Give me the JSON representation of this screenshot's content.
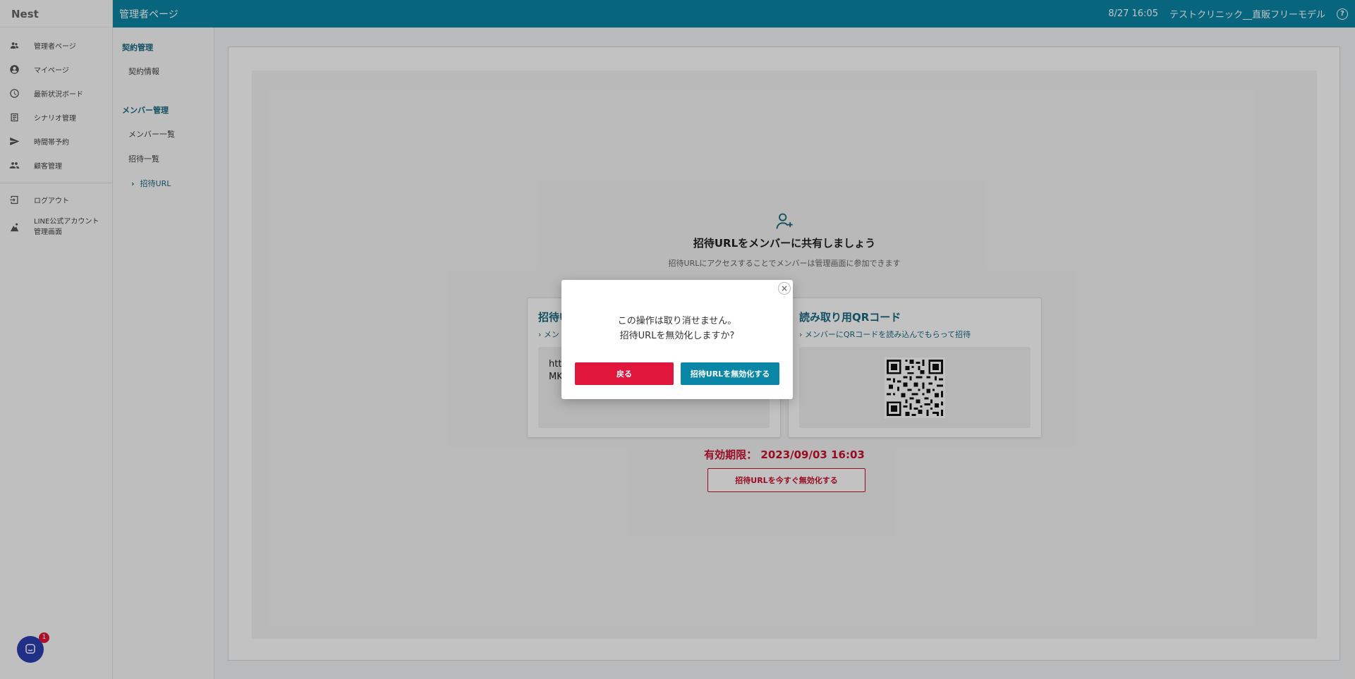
{
  "app": {
    "brand": "Nest"
  },
  "sidebar": {
    "items": [
      {
        "label": "管理者ページ",
        "icon": "users-icon"
      },
      {
        "label": "マイページ",
        "icon": "account-circle-icon"
      },
      {
        "label": "最新状況ボード",
        "icon": "clock-icon"
      },
      {
        "label": "シナリオ管理",
        "icon": "list-icon"
      },
      {
        "label": "時間帯予約",
        "icon": "send-icon"
      },
      {
        "label": "顧客管理",
        "icon": "group-icon"
      }
    ],
    "logout": "ログアウト",
    "line_admin": [
      "LINE公式アカウント",
      "管理画面"
    ]
  },
  "header": {
    "title": "管理者ページ",
    "datetime": "8/27 16:05",
    "clinic": "テストクリニック__直販フリーモデル",
    "help": "?"
  },
  "subnav": {
    "contract_section": "契約管理",
    "contract_info": "契約情報",
    "member_section": "メンバー管理",
    "member_list": "メンバー一覧",
    "invite_list": "招待一覧",
    "invite_url": "招待URL"
  },
  "main": {
    "heading": "招待URLをメンバーに共有しましょう",
    "subheading": "招待URLにアクセスすることでメンバーは管理画面に参加できます",
    "url_card": {
      "title": "招待U",
      "hint": "メン",
      "url_lines": [
        "htt",
        "MK"
      ]
    },
    "qr_card": {
      "title": "読み取り用QRコード",
      "hint": "メンバーにQRコードを読み込んでもらって招待"
    },
    "expiry": "有効期限： 2023/09/03 16:03",
    "revoke_now": "招待URLを今すぐ無効化する"
  },
  "modal": {
    "line1": "この操作は取り消せません。",
    "line2": "招待URLを無効化しますか?",
    "back": "戻る",
    "revoke": "招待URLを無効化する",
    "close": "×"
  },
  "chat": {
    "badge": "1"
  },
  "colors": {
    "accent": "#0a86a6",
    "danger": "#e0163d"
  }
}
